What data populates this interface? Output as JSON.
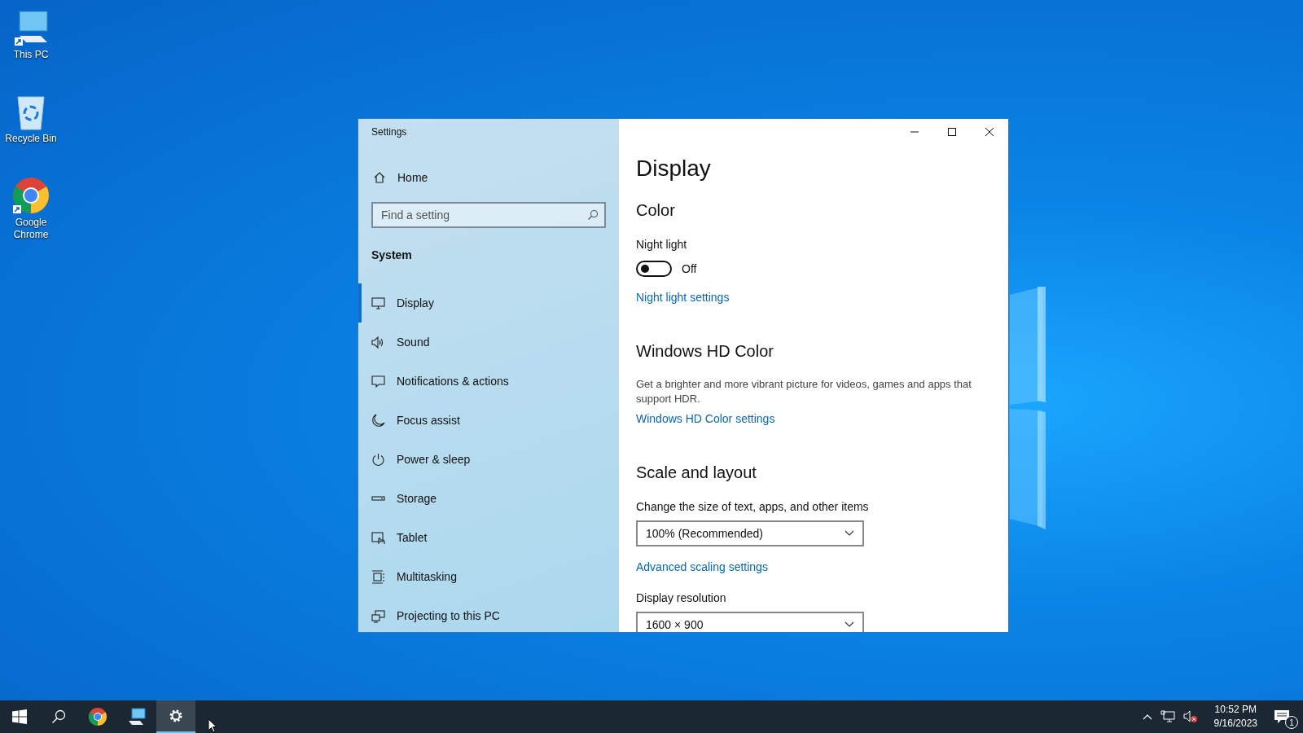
{
  "desktop_icons": [
    {
      "label": "This PC",
      "kind": "pc"
    },
    {
      "label": "Recycle Bin",
      "kind": "bin"
    },
    {
      "label": "Google Chrome",
      "kind": "chrome"
    }
  ],
  "window": {
    "title": "Settings"
  },
  "sidebar": {
    "home": "Home",
    "search": {
      "placeholder": "Find a setting"
    },
    "section": "System",
    "items": [
      {
        "label": "Display",
        "selected": true
      },
      {
        "label": "Sound",
        "selected": false
      },
      {
        "label": "Notifications & actions",
        "selected": false
      },
      {
        "label": "Focus assist",
        "selected": false
      },
      {
        "label": "Power & sleep",
        "selected": false
      },
      {
        "label": "Storage",
        "selected": false
      },
      {
        "label": "Tablet",
        "selected": false
      },
      {
        "label": "Multitasking",
        "selected": false
      },
      {
        "label": "Projecting to this PC",
        "selected": false
      }
    ]
  },
  "content": {
    "title": "Display",
    "blocks": [
      {
        "kind": "heading",
        "text": "Color"
      },
      {
        "kind": "label",
        "text": "Night light"
      },
      {
        "kind": "toggle",
        "on": false,
        "text": "Off"
      },
      {
        "kind": "link",
        "text": "Night light settings"
      },
      {
        "kind": "heading",
        "text": "Windows HD Color"
      },
      {
        "kind": "text",
        "text": "Get a brighter and more vibrant picture for videos, games and apps that support HDR."
      },
      {
        "kind": "link",
        "text": "Windows HD Color settings"
      },
      {
        "kind": "heading",
        "text": "Scale and layout"
      },
      {
        "kind": "label",
        "text": "Change the size of text, apps, and other items"
      },
      {
        "kind": "dropdown",
        "text": "100% (Recommended)"
      },
      {
        "kind": "link",
        "text": "Advanced scaling settings"
      },
      {
        "kind": "label",
        "text": "Display resolution"
      },
      {
        "kind": "dropdown",
        "text": "1600 × 900"
      }
    ]
  },
  "taskbar": {
    "apps": [
      {
        "kind": "start",
        "selected": false
      },
      {
        "kind": "search",
        "selected": false
      },
      {
        "kind": "chrome",
        "selected": false
      },
      {
        "kind": "explorer",
        "selected": false
      },
      {
        "kind": "settings",
        "selected": true
      }
    ],
    "time": "10:52 PM",
    "date": "9/16/2023",
    "notification_count": "1"
  }
}
